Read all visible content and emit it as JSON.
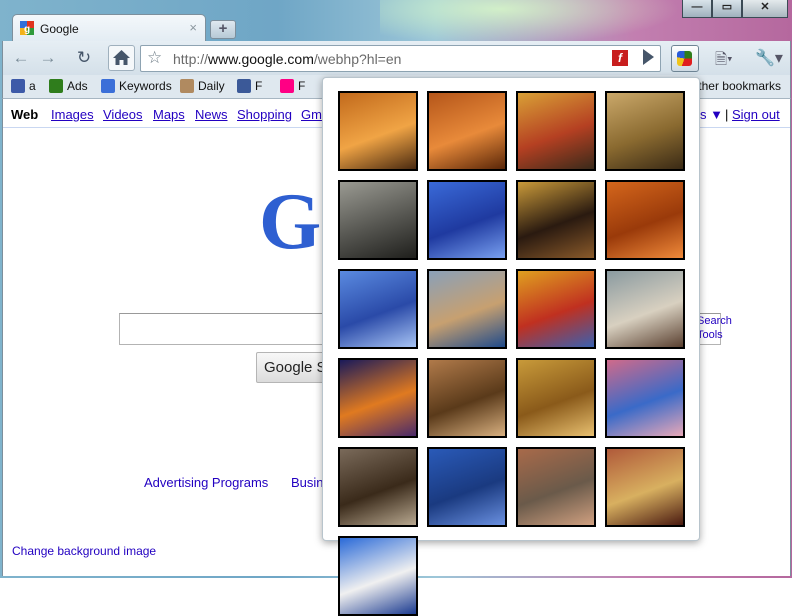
{
  "window": {
    "controls": [
      "—",
      "▭",
      "✕"
    ]
  },
  "tab": {
    "title": "Google",
    "close": "×",
    "new_tab": "+"
  },
  "toolbar": {
    "url_prefix": "http://",
    "url_host": "www.google.com",
    "url_path": "/webhp?hl=en",
    "flash_label": "f"
  },
  "bookmarks": [
    {
      "label": "a",
      "icon": "person-icon",
      "color": "#3d5aa8"
    },
    {
      "label": "Ads",
      "icon": "google-icon",
      "color": "#2f7d1c"
    },
    {
      "label": "Keywords",
      "icon": "google-icon",
      "color": "#3b6fd8"
    },
    {
      "label": "Daily",
      "icon": "page-icon",
      "color": "#b08a60"
    },
    {
      "label": "F",
      "icon": "facebook-icon",
      "color": "#3b5998"
    },
    {
      "label": "F",
      "icon": "flickr-icon",
      "color": "#ff0084"
    },
    {
      "label": "Other bookmarks",
      "icon": "folder-icon",
      "color": "#e2b24c"
    }
  ],
  "nav": {
    "links": [
      "Web",
      "Images",
      "Videos",
      "Maps",
      "News",
      "Shopping",
      "Gm"
    ],
    "right_partial": "s ▼",
    "separator": "|",
    "sign_out": "Sign out"
  },
  "search": {
    "logo_partial": "Go",
    "button_partial": "Google S",
    "side_links": [
      "Search",
      "Tools"
    ]
  },
  "footer": {
    "links": [
      "Advertising Programs",
      "Busin"
    ],
    "change_background": "Change background image"
  },
  "gallery": {
    "thumbnails": [
      {
        "subject": "sand dunes with camel riders",
        "colors": [
          "#c26a1c",
          "#f0a445",
          "#4a2a10"
        ]
      },
      {
        "subject": "orange desert dunes",
        "colors": [
          "#b5561a",
          "#e88a3a",
          "#5a2608"
        ]
      },
      {
        "subject": "spice cones at market",
        "colors": [
          "#d9a036",
          "#b54022",
          "#3a2a1a"
        ]
      },
      {
        "subject": "golden desert plains",
        "colors": [
          "#caa86a",
          "#8a6a30",
          "#3a2a15"
        ]
      },
      {
        "subject": "old wooden door black and white",
        "colors": [
          "#9a9a92",
          "#555550",
          "#1f1f1c"
        ]
      },
      {
        "subject": "blue wall with potted plants",
        "colors": [
          "#3a6ad8",
          "#1f3aa0",
          "#79a0f0"
        ]
      },
      {
        "subject": "arched doorway with lantern",
        "colors": [
          "#c99a3a",
          "#2a1a10",
          "#8a5a2a"
        ]
      },
      {
        "subject": "rippled red dunes",
        "colors": [
          "#d4661c",
          "#9a3a0a",
          "#f08a3a"
        ]
      },
      {
        "subject": "blue painted stairs",
        "colors": [
          "#5a8ae0",
          "#2a4aa8",
          "#a8c4f4"
        ]
      },
      {
        "subject": "blue boat on shore",
        "colors": [
          "#8aa0b8",
          "#c7a070",
          "#1f4a8a"
        ]
      },
      {
        "subject": "colorful abstract tiles",
        "colors": [
          "#e0a020",
          "#c03020",
          "#3a60b0"
        ]
      },
      {
        "subject": "boy holding a lamb",
        "colors": [
          "#8a9aa0",
          "#d8d0c0",
          "#5a4030"
        ]
      },
      {
        "subject": "minaret at night",
        "colors": [
          "#1a1a5a",
          "#e07a20",
          "#4a2a6a"
        ]
      },
      {
        "subject": "rocky canyon",
        "colors": [
          "#b07a4a",
          "#5a3a1a",
          "#d8b080"
        ]
      },
      {
        "subject": "ochre wall with window",
        "colors": [
          "#c89a3a",
          "#8a5a1a",
          "#e8c070"
        ]
      },
      {
        "subject": "pink wall with blue door",
        "colors": [
          "#d06a8a",
          "#3a6ac8",
          "#e8a8b8"
        ]
      },
      {
        "subject": "street scene with bicycles",
        "colors": [
          "#7a6a5a",
          "#3a2a1a",
          "#b8a890"
        ]
      },
      {
        "subject": "blue door with knocker",
        "colors": [
          "#2a5ab8",
          "#1a3a80",
          "#6a90e0"
        ]
      },
      {
        "subject": "kasbah village",
        "colors": [
          "#a86a4a",
          "#6a5a4a",
          "#d0a080"
        ]
      },
      {
        "subject": "ornate brass door knockers",
        "colors": [
          "#b05a3a",
          "#d8b060",
          "#4a1a10"
        ]
      },
      {
        "subject": "blue and white arched doorway",
        "colors": [
          "#2a6ad8",
          "#f0f0f0",
          "#1a3a90"
        ]
      }
    ]
  }
}
